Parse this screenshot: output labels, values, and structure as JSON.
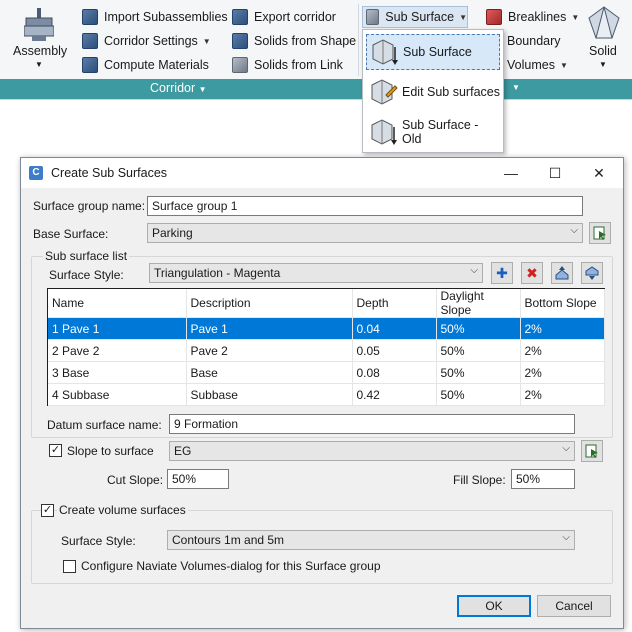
{
  "ribbon": {
    "assembly_label": "Assembly",
    "import_subassemblies": "Import Subassemblies",
    "corridor_settings": "Corridor Settings",
    "compute_materials": "Compute Materials",
    "export_corridor": "Export corridor",
    "solids_from_shape": "Solids from Shape",
    "solids_from_link": "Solids from Link",
    "sub_surface": "Sub Surface",
    "breaklines": "Breaklines",
    "boundary": "Boundary",
    "volumes": "Volumes",
    "solid": "Solid",
    "panel_label": "Corridor",
    "accent_color": "#3c9aa0"
  },
  "dropdown": {
    "items": [
      {
        "label": "Sub Surface"
      },
      {
        "label": "Edit Sub surfaces"
      },
      {
        "label": "Sub Surface - Old"
      }
    ]
  },
  "dialog": {
    "title": "Create Sub Surfaces",
    "surface_group_name_label": "Surface group name:",
    "surface_group_name_value": "Surface group 1",
    "base_surface_label": "Base Surface:",
    "base_surface_value": "Parking",
    "sub_surface_list_label": "Sub surface list",
    "surface_style_label": "Surface Style:",
    "surface_style_value": "Triangulation - Magenta",
    "table": {
      "columns": [
        "Name",
        "Description",
        "Depth",
        "Daylight Slope",
        "Bottom Slope"
      ],
      "rows": [
        [
          "1 Pave 1",
          "Pave 1",
          "0.04",
          "50%",
          "2%"
        ],
        [
          "2 Pave 2",
          "Pave 2",
          "0.05",
          "50%",
          "2%"
        ],
        [
          "3 Base",
          "Base",
          "0.08",
          "50%",
          "2%"
        ],
        [
          "4 Subbase",
          "Subbase",
          "0.42",
          "50%",
          "2%"
        ]
      ]
    },
    "datum_surface_label": "Datum surface name:",
    "datum_surface_value": "9 Formation",
    "slope_to_surface_label": "Slope to surface",
    "slope_to_surface_checked": "✓",
    "slope_to_surface_value": "EG",
    "cut_slope_label": "Cut Slope:",
    "cut_slope_value": "50%",
    "fill_slope_label": "Fill Slope:",
    "fill_slope_value": "50%",
    "create_volume_label": "Create volume surfaces",
    "create_volume_checked": "✓",
    "volume_style_label": "Surface Style:",
    "volume_style_value": "Contours 1m and 5m",
    "configure_label": "Configure Naviate Volumes-dialog for this Surface group",
    "ok_label": "OK",
    "cancel_label": "Cancel",
    "minimize_glyph": "—",
    "maximize_glyph": "☐",
    "close_glyph": "✕"
  }
}
